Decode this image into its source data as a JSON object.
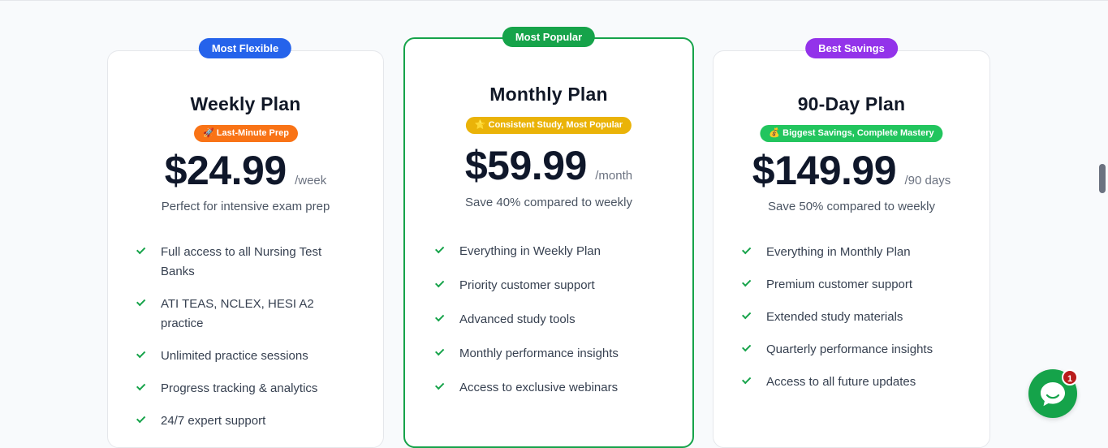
{
  "colors": {
    "flexible": "#2563eb",
    "popular": "#16a34a",
    "savings": "#9333ea",
    "tag_weekly": "#f97316",
    "tag_monthly": "#eab308",
    "tag_ninety": "#22c55e",
    "check": "#16a34a"
  },
  "plans": [
    {
      "badge": "Most Flexible",
      "title": "Weekly Plan",
      "tag_icon": "rocket-icon",
      "tag_text": "🚀 Last-Minute Prep",
      "price": "$24.99",
      "period": "/week",
      "note": "Perfect for intensive exam prep",
      "features": [
        "Full access to all Nursing Test Banks",
        "ATI TEAS, NCLEX, HESI A2 practice",
        "Unlimited practice sessions",
        "Progress tracking & analytics",
        "24/7 expert support"
      ]
    },
    {
      "badge": "Most Popular",
      "title": "Monthly Plan",
      "tag_icon": "star-icon",
      "tag_text": "⭐ Consistent Study, Most Popular",
      "price": "$59.99",
      "period": "/month",
      "note": "Save 40% compared to weekly",
      "features": [
        "Everything in Weekly Plan",
        "Priority customer support",
        "Advanced study tools",
        "Monthly performance insights",
        "Access to exclusive webinars"
      ]
    },
    {
      "badge": "Best Savings",
      "title": "90-Day Plan",
      "tag_icon": "money-bag-icon",
      "tag_text": "💰 Biggest Savings, Complete Mastery",
      "price": "$149.99",
      "period": "/90 days",
      "note": "Save 50% compared to weekly",
      "features": [
        "Everything in Monthly Plan",
        "Premium customer support",
        "Extended study materials",
        "Quarterly performance insights",
        "Access to all future updates"
      ]
    }
  ],
  "chat": {
    "icon": "chat-bubble-icon",
    "badge_count": "1"
  }
}
